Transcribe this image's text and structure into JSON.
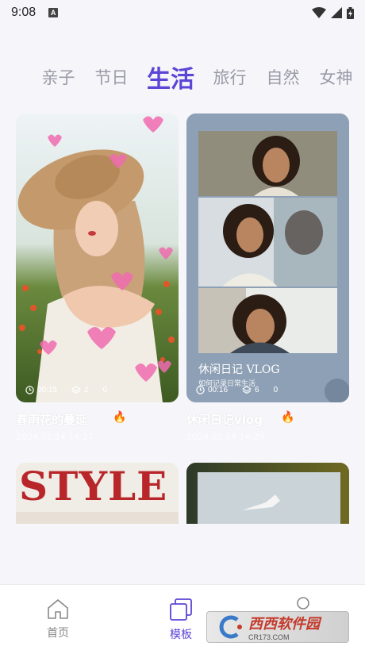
{
  "status_bar": {
    "time": "9:08",
    "notif_letter": "A"
  },
  "tabs": [
    {
      "label": "亲子",
      "active": false
    },
    {
      "label": "节日",
      "active": false
    },
    {
      "label": "生活",
      "active": true
    },
    {
      "label": "旅行",
      "active": false
    },
    {
      "label": "自然",
      "active": false
    },
    {
      "label": "女神",
      "active": false
    }
  ],
  "cards": [
    {
      "duration": "00:15",
      "layers": "2",
      "count": "0",
      "title": "春雨花的蔓延",
      "subtitle": "2024.01.14 14:27"
    },
    {
      "overlay_title": "休闲日记 VLOG",
      "overlay_subtitle": "如何记录日常生活",
      "duration": "00:16",
      "layers": "6",
      "count": "0",
      "title": "休闲日记vlog",
      "subtitle": "2024.01.14 14:29"
    },
    {
      "headline": "STYLE"
    },
    {}
  ],
  "bottom_nav": {
    "home": "首页",
    "templates": "模板"
  },
  "watermark": {
    "main": "西西软件园",
    "sub": "CR173.COM"
  },
  "colors": {
    "accent": "#5b45d6",
    "tab_inactive": "#9a9aa8"
  }
}
